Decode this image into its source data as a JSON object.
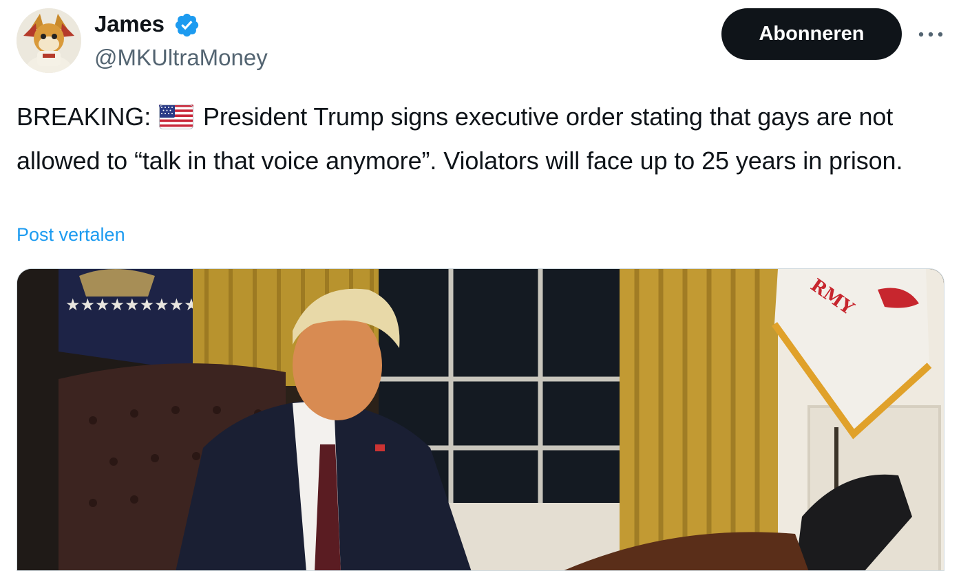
{
  "post": {
    "author": {
      "display_name": "James",
      "handle": "@MKUltraMoney",
      "verified": true,
      "avatar_icon": "cartoon-character-avatar",
      "verified_icon": "verified-badge-icon"
    },
    "follow_label": "Abonneren",
    "more_icon": "more-options-icon",
    "text": {
      "prefix": "BREAKING:",
      "emoji": "us-flag-icon",
      "body": " President Trump signs executive order stating that gays are not allowed to “talk in that voice anymore”. Violators will face up to 25 years in prison."
    },
    "translate_label": "Post vertalen",
    "media": {
      "type": "photo",
      "flag_text": "RMY"
    }
  },
  "colors": {
    "text": "#0f1419",
    "secondary": "#536471",
    "link": "#1d9bf0",
    "button_bg": "#0f1419",
    "verified": "#1d9bf0"
  }
}
